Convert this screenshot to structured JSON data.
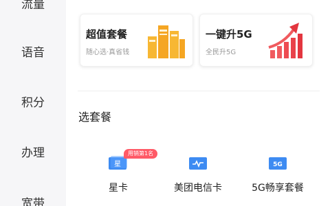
{
  "sidebar": {
    "items": [
      {
        "label": "流量"
      },
      {
        "label": "语音"
      },
      {
        "label": "积分"
      },
      {
        "label": "办理"
      },
      {
        "label": "宽带"
      }
    ]
  },
  "cards": [
    {
      "title": "超值套餐",
      "subtitle": "随心选·真省钱",
      "icon": "folders-illustration-icon",
      "accent": "#f5a623"
    },
    {
      "title": "一键升5G",
      "subtitle": "全民升5G",
      "icon": "rising-bars-arrow-icon",
      "accent": "#f0454e"
    }
  ],
  "section": {
    "title": "选套餐"
  },
  "packages": [
    {
      "label": "星卡",
      "icon": "star-card-icon",
      "badge": "用销第1名"
    },
    {
      "label": "美团电信卡",
      "icon": "meituan-card-icon"
    },
    {
      "label": "5G畅享套餐",
      "icon": "5g-package-icon",
      "icon_text": "5G"
    }
  ],
  "colors": {
    "icon_blue": "#3d8bf2",
    "badge_red": "#ff5a67"
  }
}
